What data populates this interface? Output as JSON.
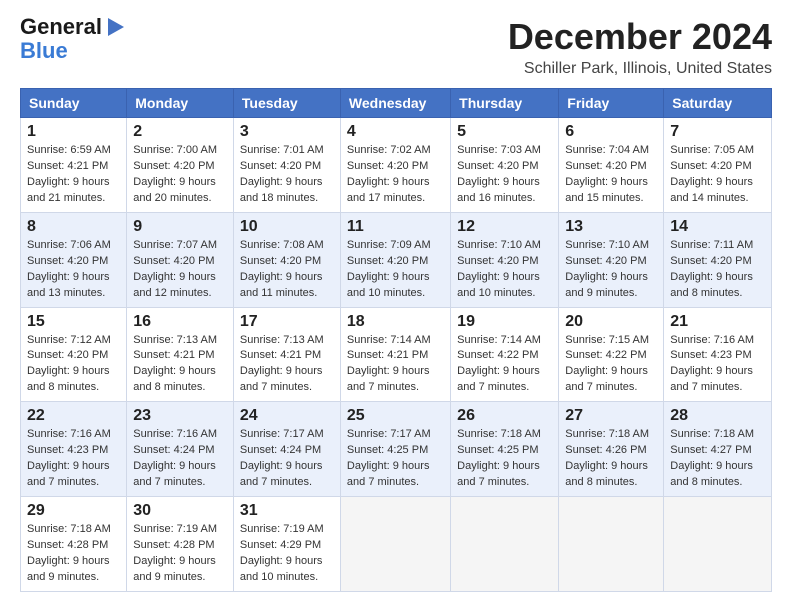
{
  "header": {
    "logo_line1": "General",
    "logo_line2": "Blue",
    "month": "December 2024",
    "location": "Schiller Park, Illinois, United States"
  },
  "columns": [
    "Sunday",
    "Monday",
    "Tuesday",
    "Wednesday",
    "Thursday",
    "Friday",
    "Saturday"
  ],
  "weeks": [
    [
      {
        "day": "1",
        "info": "Sunrise: 6:59 AM\nSunset: 4:21 PM\nDaylight: 9 hours\nand 21 minutes."
      },
      {
        "day": "2",
        "info": "Sunrise: 7:00 AM\nSunset: 4:20 PM\nDaylight: 9 hours\nand 20 minutes."
      },
      {
        "day": "3",
        "info": "Sunrise: 7:01 AM\nSunset: 4:20 PM\nDaylight: 9 hours\nand 18 minutes."
      },
      {
        "day": "4",
        "info": "Sunrise: 7:02 AM\nSunset: 4:20 PM\nDaylight: 9 hours\nand 17 minutes."
      },
      {
        "day": "5",
        "info": "Sunrise: 7:03 AM\nSunset: 4:20 PM\nDaylight: 9 hours\nand 16 minutes."
      },
      {
        "day": "6",
        "info": "Sunrise: 7:04 AM\nSunset: 4:20 PM\nDaylight: 9 hours\nand 15 minutes."
      },
      {
        "day": "7",
        "info": "Sunrise: 7:05 AM\nSunset: 4:20 PM\nDaylight: 9 hours\nand 14 minutes."
      }
    ],
    [
      {
        "day": "8",
        "info": "Sunrise: 7:06 AM\nSunset: 4:20 PM\nDaylight: 9 hours\nand 13 minutes."
      },
      {
        "day": "9",
        "info": "Sunrise: 7:07 AM\nSunset: 4:20 PM\nDaylight: 9 hours\nand 12 minutes."
      },
      {
        "day": "10",
        "info": "Sunrise: 7:08 AM\nSunset: 4:20 PM\nDaylight: 9 hours\nand 11 minutes."
      },
      {
        "day": "11",
        "info": "Sunrise: 7:09 AM\nSunset: 4:20 PM\nDaylight: 9 hours\nand 10 minutes."
      },
      {
        "day": "12",
        "info": "Sunrise: 7:10 AM\nSunset: 4:20 PM\nDaylight: 9 hours\nand 10 minutes."
      },
      {
        "day": "13",
        "info": "Sunrise: 7:10 AM\nSunset: 4:20 PM\nDaylight: 9 hours\nand 9 minutes."
      },
      {
        "day": "14",
        "info": "Sunrise: 7:11 AM\nSunset: 4:20 PM\nDaylight: 9 hours\nand 8 minutes."
      }
    ],
    [
      {
        "day": "15",
        "info": "Sunrise: 7:12 AM\nSunset: 4:20 PM\nDaylight: 9 hours\nand 8 minutes."
      },
      {
        "day": "16",
        "info": "Sunrise: 7:13 AM\nSunset: 4:21 PM\nDaylight: 9 hours\nand 8 minutes."
      },
      {
        "day": "17",
        "info": "Sunrise: 7:13 AM\nSunset: 4:21 PM\nDaylight: 9 hours\nand 7 minutes."
      },
      {
        "day": "18",
        "info": "Sunrise: 7:14 AM\nSunset: 4:21 PM\nDaylight: 9 hours\nand 7 minutes."
      },
      {
        "day": "19",
        "info": "Sunrise: 7:14 AM\nSunset: 4:22 PM\nDaylight: 9 hours\nand 7 minutes."
      },
      {
        "day": "20",
        "info": "Sunrise: 7:15 AM\nSunset: 4:22 PM\nDaylight: 9 hours\nand 7 minutes."
      },
      {
        "day": "21",
        "info": "Sunrise: 7:16 AM\nSunset: 4:23 PM\nDaylight: 9 hours\nand 7 minutes."
      }
    ],
    [
      {
        "day": "22",
        "info": "Sunrise: 7:16 AM\nSunset: 4:23 PM\nDaylight: 9 hours\nand 7 minutes."
      },
      {
        "day": "23",
        "info": "Sunrise: 7:16 AM\nSunset: 4:24 PM\nDaylight: 9 hours\nand 7 minutes."
      },
      {
        "day": "24",
        "info": "Sunrise: 7:17 AM\nSunset: 4:24 PM\nDaylight: 9 hours\nand 7 minutes."
      },
      {
        "day": "25",
        "info": "Sunrise: 7:17 AM\nSunset: 4:25 PM\nDaylight: 9 hours\nand 7 minutes."
      },
      {
        "day": "26",
        "info": "Sunrise: 7:18 AM\nSunset: 4:25 PM\nDaylight: 9 hours\nand 7 minutes."
      },
      {
        "day": "27",
        "info": "Sunrise: 7:18 AM\nSunset: 4:26 PM\nDaylight: 9 hours\nand 8 minutes."
      },
      {
        "day": "28",
        "info": "Sunrise: 7:18 AM\nSunset: 4:27 PM\nDaylight: 9 hours\nand 8 minutes."
      }
    ],
    [
      {
        "day": "29",
        "info": "Sunrise: 7:18 AM\nSunset: 4:28 PM\nDaylight: 9 hours\nand 9 minutes."
      },
      {
        "day": "30",
        "info": "Sunrise: 7:19 AM\nSunset: 4:28 PM\nDaylight: 9 hours\nand 9 minutes."
      },
      {
        "day": "31",
        "info": "Sunrise: 7:19 AM\nSunset: 4:29 PM\nDaylight: 9 hours\nand 10 minutes."
      },
      {
        "day": "",
        "info": ""
      },
      {
        "day": "",
        "info": ""
      },
      {
        "day": "",
        "info": ""
      },
      {
        "day": "",
        "info": ""
      }
    ]
  ]
}
